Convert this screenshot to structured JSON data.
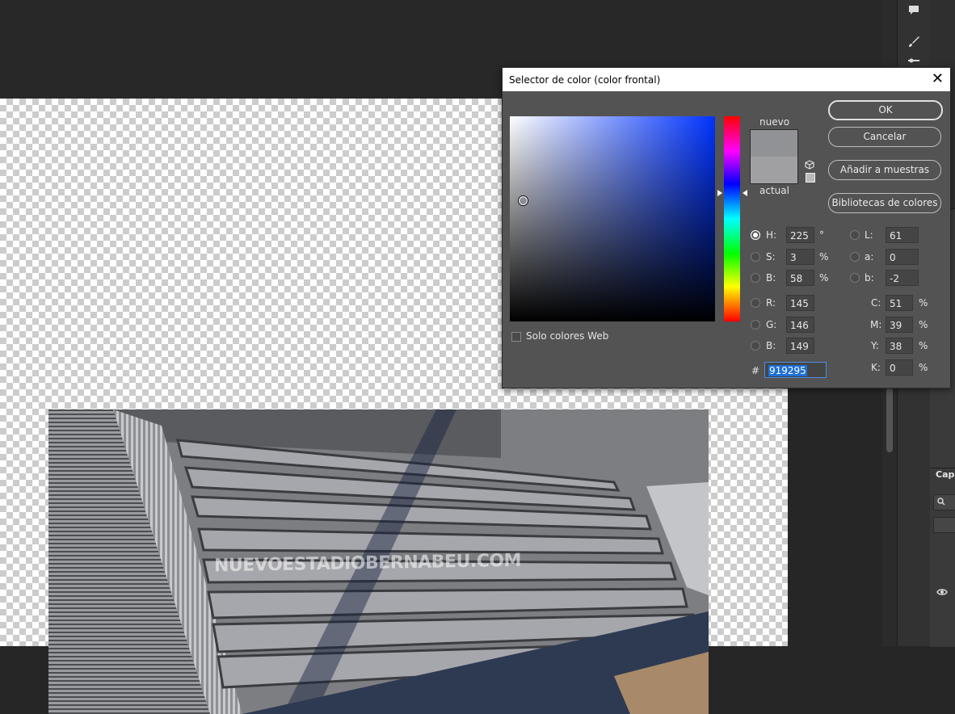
{
  "dialog": {
    "title": "Selector de color (color frontal)",
    "close_glyph": "✕",
    "new_label": "nuevo",
    "current_label": "actual",
    "new_color": "#919295",
    "current_color": "#a0a0a2",
    "buttons": {
      "ok": "OK",
      "cancel": "Cancelar",
      "add_swatch": "Añadir a muestras",
      "libraries": "Bibliotecas de colores"
    },
    "web_only_label": "Solo colores Web",
    "hsb": {
      "h_label": "H:",
      "h_value": "225",
      "h_unit": "°",
      "s_label": "S:",
      "s_value": "3",
      "s_unit": "%",
      "b_label": "B:",
      "b_value": "58",
      "b_unit": "%"
    },
    "rgb": {
      "r_label": "R:",
      "r_value": "145",
      "g_label": "G:",
      "g_value": "146",
      "b_label": "B:",
      "b_value": "149"
    },
    "lab": {
      "l_label": "L:",
      "l_value": "61",
      "a_label": "a:",
      "a_value": "0",
      "b_label": "b:",
      "b_value": "-2"
    },
    "cmyk": {
      "c_label": "C:",
      "c_value": "51",
      "m_label": "M:",
      "m_value": "39",
      "y_label": "Y:",
      "y_value": "38",
      "k_label": "K:",
      "k_value": "0",
      "unit": "%"
    },
    "hex_label": "#",
    "hex_value": "919295",
    "selected_mode": "H"
  },
  "canvas": {
    "watermark": "NUEVOESTADIOBERNABEU.COM"
  },
  "panels": {
    "layers_title": "Capa"
  },
  "icons": {
    "comment": "speech-bubble-icon",
    "brush": "brush-icon",
    "adjust": "sliders-icon",
    "cube": "cube-icon",
    "web_square": "web-safe-icon",
    "eye": "eye-icon"
  }
}
